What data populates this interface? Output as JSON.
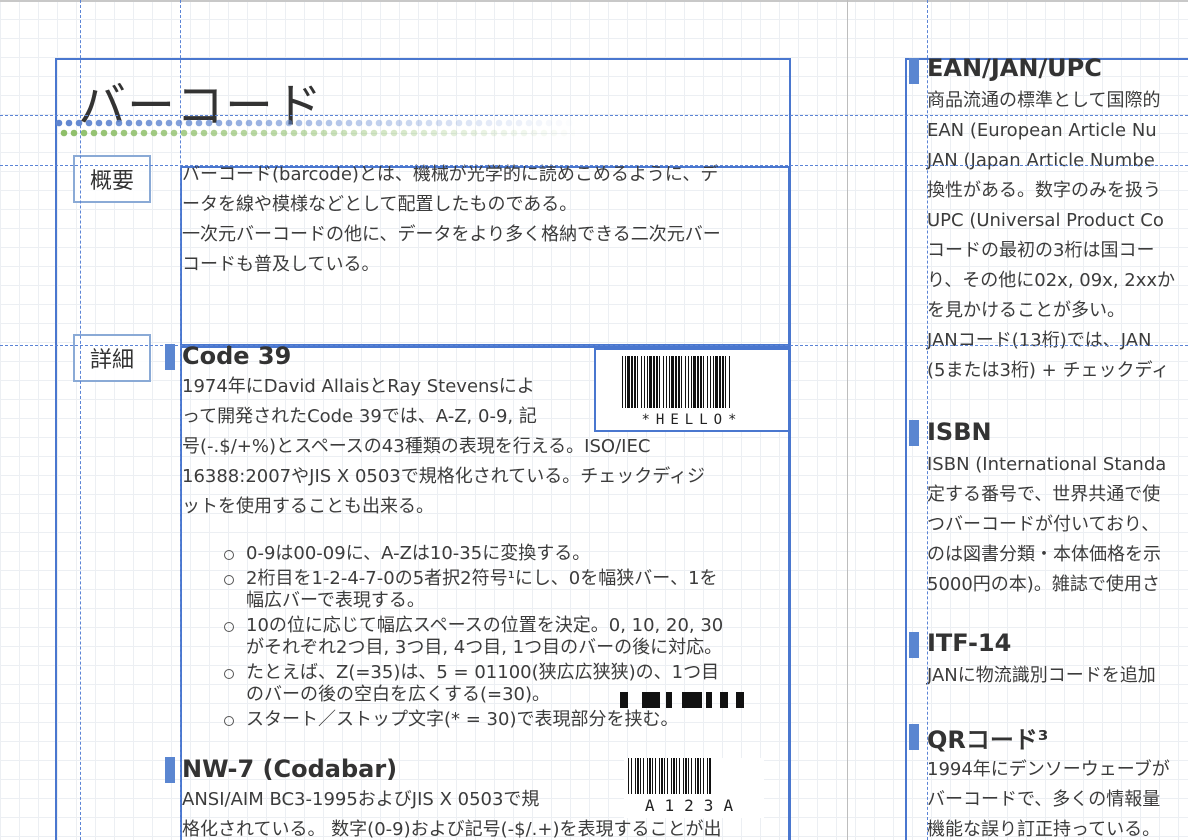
{
  "left": {
    "title": "バーコード",
    "overview": {
      "label": "概要",
      "lines": [
        "バーコード(barcode)とは、機械が光学的に読めこめるように、デ",
        "ータを線や模様などとして配置したものである。",
        "一次元バーコードの他に、データをより多く格納できる二次元バー",
        "コードも普及している。"
      ]
    },
    "detail": {
      "label": "詳細",
      "code39": {
        "heading": "Code 39",
        "barcode_text": "*HELLO*",
        "lines": [
          "1974年にDavid AllaisとRay Stevensによ",
          "って開発されたCode 39では、A-Z, 0-9, 記",
          "号(-.$/+%)とスペースの43種類の表現を行える。ISO/IEC",
          "16388:2007やJIS X 0503で規格化されている。チェックディジ",
          "ットを使用することも出来る。"
        ],
        "bullets": [
          [
            "0-9は00-09に、A-Zは10-35に変換する。"
          ],
          [
            "2桁目を1-2-4-7-0の5者択2符号¹にし、0を幅狭バー、1を",
            "幅広バーで表現する。"
          ],
          [
            "10の位に応じて幅広スペースの位置を決定。0, 10, 20, 30",
            "がそれぞれ2つ目, 3つ目, 4つ目, 1つ目のバーの後に対応。"
          ],
          [
            "たとえば、Z(=35)は、5 = 01100(狭広広狭狭)の、1つ目",
            "のバーの後の空白を広くする(=30)。"
          ],
          [
            "スタート／ストップ文字(* = 30)で表現部分を挟む。"
          ]
        ]
      },
      "nw7": {
        "heading": "NW-7 (Codabar)",
        "barcode_text": "A123A",
        "lines": [
          "ANSI/AIM BC3-1995およびJIS X 0503で規",
          "格化されている。 数字(0-9)および記号(-$/.+)を表現することが出"
        ]
      }
    }
  },
  "right": {
    "ean": {
      "heading": "EAN/JAN/UPC",
      "lines": [
        "商品流通の標準として国際的",
        "EAN (European Article Nu",
        "JAN (Japan Article Numbe",
        "換性がある。数字のみを扱う",
        "UPC (Universal Product Co",
        "コードの最初の3桁は国コー",
        "り、その他に02x, 09x, 2xxか",
        "を見かけることが多い。",
        "JANコード(13桁)では、JAN",
        "(5または3桁) + チェックディ"
      ]
    },
    "isbn": {
      "heading": "ISBN",
      "lines": [
        "ISBN (International Standa",
        "定する番号で、世界共通で使",
        "つバーコードが付いており、",
        "のは図書分類・本体価格を示",
        "5000円の本)。雑誌で使用さ"
      ]
    },
    "itf": {
      "heading": "ITF-14",
      "lines": [
        "JANに物流識別コードを追加"
      ]
    },
    "qr": {
      "heading": "QRコード³",
      "lines": [
        "1994年にデンソーウェーブが",
        "バーコードで、多くの情報量",
        "機能な誤り訂正持っている。"
      ]
    }
  }
}
